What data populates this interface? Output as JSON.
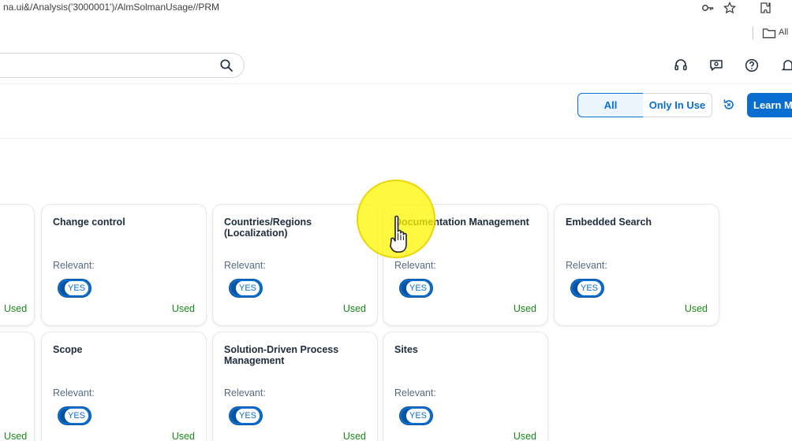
{
  "browser": {
    "url": "na.ui&/Analysis('3000001')/AlmSolmanUsage//PRM",
    "bookmark_label": "All",
    "icons": [
      "key-icon",
      "star-icon",
      "extension-icon",
      "folder-icon"
    ]
  },
  "header": {
    "search_placeholder": "",
    "icons": [
      "search-icon",
      "headset-icon",
      "chat-icon",
      "help-icon",
      "bell-icon"
    ]
  },
  "toolbar": {
    "filter_all": "All",
    "filter_in_use": "Only In Use",
    "learn_more": "Learn More",
    "accent_color": "#0a6ed1"
  },
  "cards": {
    "row1": [
      {
        "title": "Change control",
        "relevant_label": "Relevant:",
        "toggle": "YES",
        "status": "Used"
      },
      {
        "title": "Countries/Regions (Localization)",
        "relevant_label": "Relevant:",
        "toggle": "YES",
        "status": "Used"
      },
      {
        "title": "Documentation Management",
        "relevant_label": "Relevant:",
        "toggle": "YES",
        "status": "Used"
      },
      {
        "title": "Embedded Search",
        "relevant_label": "Relevant:",
        "toggle": "YES",
        "status": "Used"
      }
    ],
    "row2": [
      {
        "title": "Scope",
        "relevant_label": "Relevant:",
        "toggle": "YES",
        "status": "Used"
      },
      {
        "title": "Solution-Driven Process Management",
        "relevant_label": "Relevant:",
        "toggle": "YES",
        "status": "Used"
      },
      {
        "title": "Sites",
        "relevant_label": "Relevant:",
        "toggle": "YES",
        "status": "Used"
      }
    ],
    "partial_row1_status": "Used",
    "partial_row2_status": "Used",
    "status_color": "#188918"
  }
}
